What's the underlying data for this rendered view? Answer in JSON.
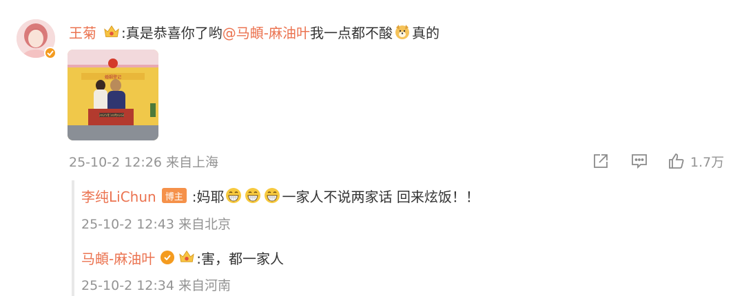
{
  "comment": {
    "username": "王菊",
    "text_before_mention": ":真是恭喜你了哟",
    "mention": "@马頔-麻油叶",
    "text_after_mention": " 我一点都不酸",
    "text_end": "真的",
    "timestamp": "25-10-2 12:26",
    "location": "来自上海",
    "like_count": "1.7万",
    "photo_sign": "2025年10月02日"
  },
  "replies": [
    {
      "username": "李纯LiChun",
      "badge": "博主",
      "text_before": ":妈耶",
      "text_after": " 一家人不说两家话 回来炫饭！！",
      "timestamp": "25-10-2 12:43",
      "location": "来自北京"
    },
    {
      "username": "马頔-麻油叶",
      "text": ":害，都一家人",
      "timestamp": "25-10-2 12:34",
      "location": "来自河南"
    }
  ],
  "icons": {
    "share": "share-icon",
    "comment": "comment-icon",
    "like": "thumbs-up-icon",
    "verified": "verified-icon",
    "crown": "crown-icon",
    "grin": "grin-emoji",
    "dog": "dog-emoji"
  },
  "colors": {
    "accent": "#eb7350",
    "meta": "#939393",
    "badge": "#f5914a",
    "verified": "#f49b1f"
  }
}
